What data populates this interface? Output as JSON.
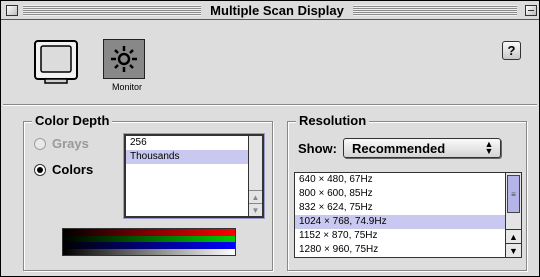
{
  "window": {
    "title": "Multiple Scan Display"
  },
  "top": {
    "monitor_caption": "Monitor",
    "help_label": "?"
  },
  "color_depth": {
    "label": "Color Depth",
    "grays_label": "Grays",
    "colors_label": "Colors",
    "selected": "Colors",
    "options": [
      "256",
      "Thousands"
    ],
    "selected_option": "Thousands"
  },
  "resolution": {
    "label": "Resolution",
    "show_label": "Show:",
    "show_value": "Recommended",
    "items": [
      "640 × 480, 67Hz",
      "800 × 600, 85Hz",
      "832 × 624, 75Hz",
      "1024 × 768, 74.9Hz",
      "1152 × 870, 75Hz",
      "1280 × 960, 75Hz"
    ],
    "selected_item": "1024 × 768, 74.9Hz"
  },
  "colors": {
    "window_bg": "#dddddd",
    "selection": "#c8c8f0",
    "gradient": [
      "#ff0000",
      "#00cc00",
      "#0000ff",
      "#ffffff"
    ]
  }
}
